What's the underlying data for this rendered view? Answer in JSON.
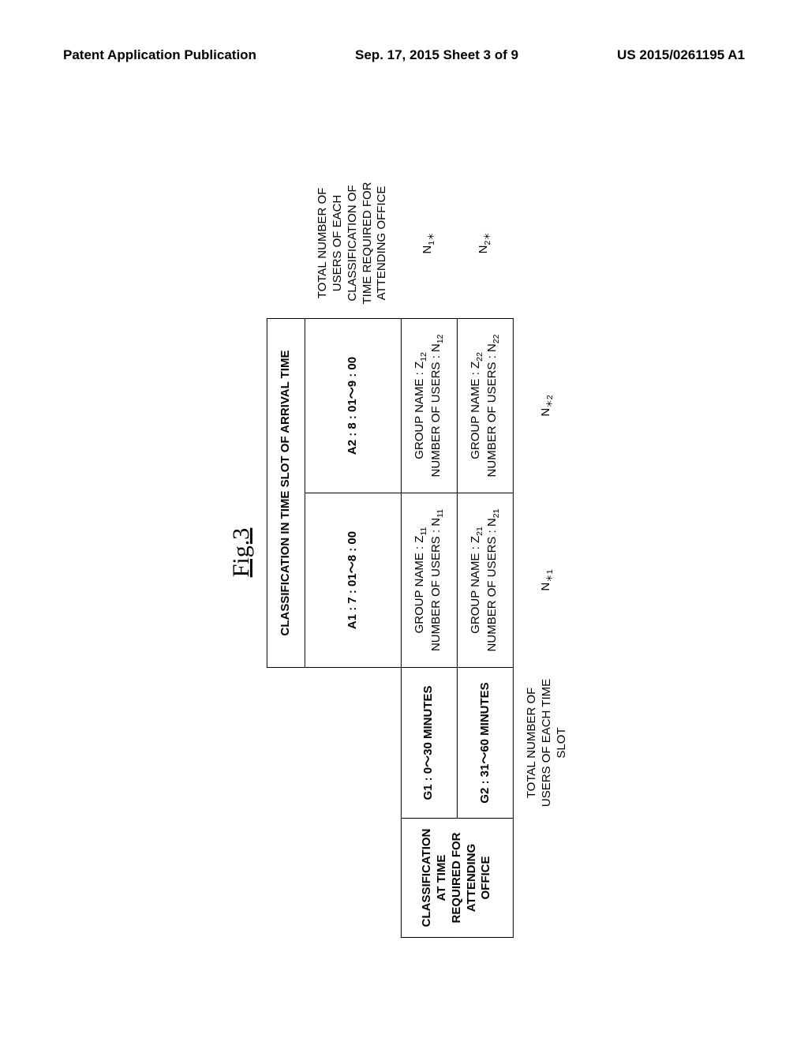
{
  "header": {
    "left": "Patent Application Publication",
    "center": "Sep. 17, 2015  Sheet 3 of 9",
    "right": "US 2015/0261195 A1"
  },
  "figure": {
    "title": "Fig.3",
    "col_group_header": "CLASSIFICATION IN TIME SLOT OF ARRIVAL TIME",
    "col_a1": "A1 : 7 : 01～8 : 00",
    "col_a2": "A2 : 8 : 01～9 : 00",
    "col_total_header": "TOTAL NUMBER OF USERS OF EACH CLASSIFICATION OF TIME REQUIRED FOR ATTENDING OFFICE",
    "row_group_header": "CLASSIFICATION AT TIME REQUIRED FOR ATTENDING OFFICE",
    "row_g1": "G1 : 0～30 MINUTES",
    "row_g2": "G2 : 31～60 MINUTES",
    "row_total_header": "TOTAL NUMBER OF USERS OF EACH TIME SLOT",
    "cell_11_group": "GROUP NAME : Z",
    "cell_11_group_sub": "11",
    "cell_11_users": "NUMBER OF USERS : N",
    "cell_11_users_sub": "11",
    "cell_12_group": "GROUP NAME : Z",
    "cell_12_group_sub": "12",
    "cell_12_users": "NUMBER OF USERS : N",
    "cell_12_users_sub": "12",
    "cell_21_group": "GROUP NAME : Z",
    "cell_21_group_sub": "21",
    "cell_21_users": "NUMBER OF USERS : N",
    "cell_21_users_sub": "21",
    "cell_22_group": "GROUP NAME : Z",
    "cell_22_group_sub": "22",
    "cell_22_users": "NUMBER OF USERS : N",
    "cell_22_users_sub": "22",
    "row1_total_sym": "N",
    "row1_total_sub": "1＊",
    "row2_total_sym": "N",
    "row2_total_sub": "2＊",
    "col1_total_sym": "N",
    "col1_total_sub": "＊1",
    "col2_total_sym": "N",
    "col2_total_sub": "＊2"
  }
}
